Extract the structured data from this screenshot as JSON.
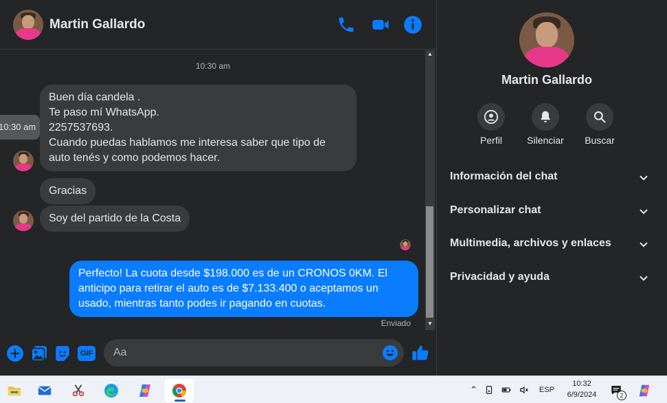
{
  "header": {
    "contact_name": "Martin Gallardo",
    "icons": [
      "phone-icon",
      "video-call-icon",
      "info-icon"
    ]
  },
  "messages": {
    "timestamp": "10:30 am",
    "hover_time": "10:30 am",
    "incoming": [
      {
        "lines": [
          "Buen día candela .",
          "Te paso mí WhatsApp.",
          "2257537693.",
          "Cuando puedas hablamos me interesa saber que tipo de",
          "auto tenés y como podemos hacer."
        ]
      },
      {
        "lines": [
          "Gracias"
        ]
      },
      {
        "lines": [
          "Soy del partido de la Costa"
        ]
      }
    ],
    "outgoing": [
      {
        "lines": [
          "Perfecto! La cuota desde $198.000 es de un CRONOS 0KM. El",
          "anticipo para retirar el auto es de $7.133.400 o aceptamos un",
          "usado, mientras tanto podes ir pagando en cuotas."
        ]
      }
    ],
    "status": "Enviado"
  },
  "composer": {
    "placeholder": "Aa",
    "value": "",
    "icons": [
      "add-icon",
      "image-icon",
      "sticker-icon",
      "gif-icon",
      "emoji-icon",
      "like-icon"
    ],
    "gif_label": "GIF"
  },
  "sidebar": {
    "contact_name": "Martin Gallardo",
    "actions": [
      {
        "label": "Perfil",
        "icon": "profile-icon"
      },
      {
        "label": "Silenciar",
        "icon": "bell-icon"
      },
      {
        "label": "Buscar",
        "icon": "search-icon"
      }
    ],
    "sections": [
      {
        "label": "Información del chat"
      },
      {
        "label": "Personalizar chat"
      },
      {
        "label": "Multimedia, archivos y enlaces"
      },
      {
        "label": "Privacidad y ayuda"
      }
    ]
  },
  "taskbar": {
    "apps": [
      "file-explorer-icon",
      "mail-icon",
      "snipping-tool-icon",
      "edge-icon",
      "copilot-icon",
      "chrome-icon"
    ],
    "language": "ESP",
    "time": "10:32",
    "date": "6/9/2024",
    "notification_count": "2"
  },
  "colors": {
    "accent": "#0a7cff",
    "background": "#242526",
    "bubble_incoming": "#3a3b3c"
  }
}
